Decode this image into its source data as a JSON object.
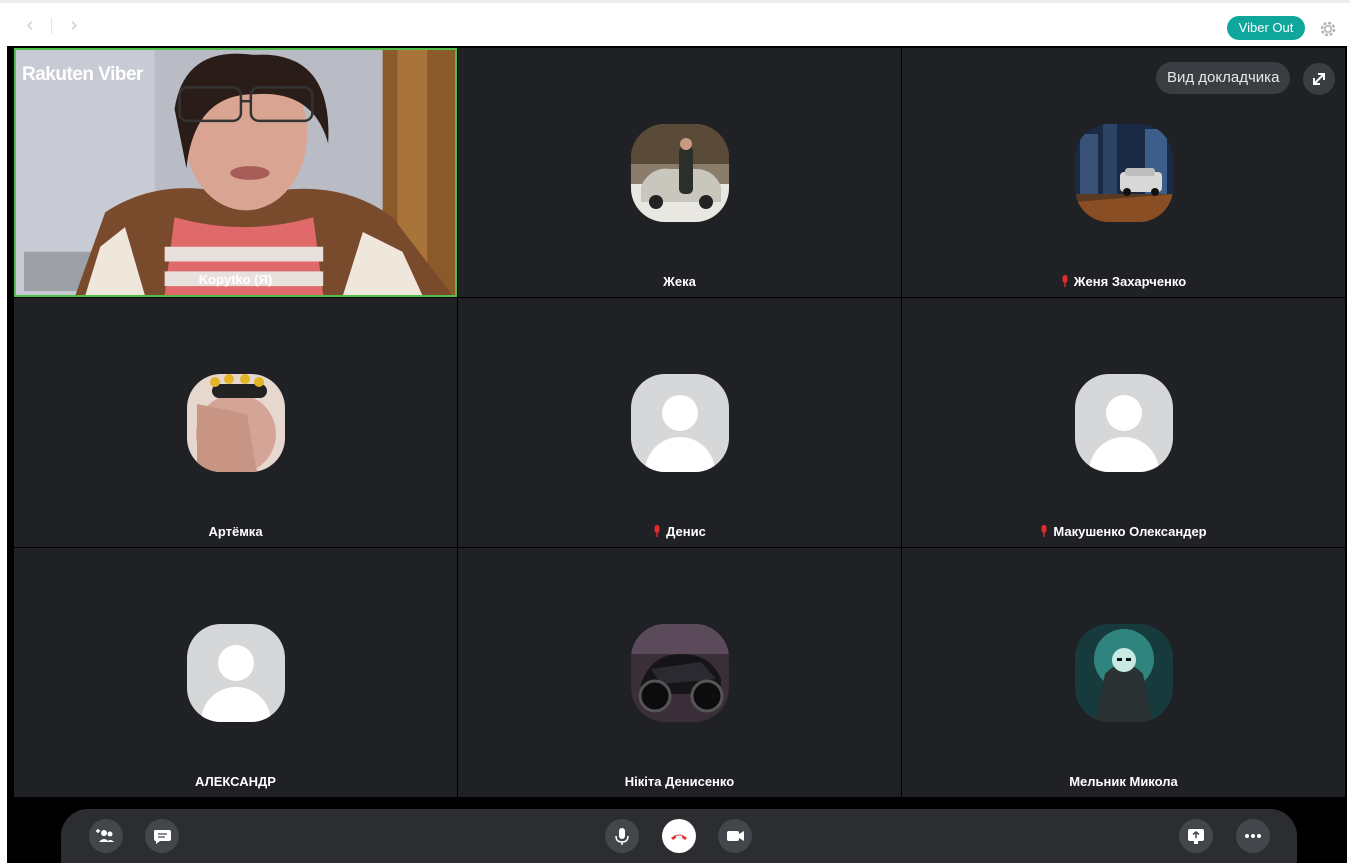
{
  "app": {
    "brand": "Rakuten Viber"
  },
  "topbar": {
    "viber_out_label": "Viber Out",
    "back_icon": "chevron-left-icon",
    "forward_icon": "chevron-right-icon",
    "settings_icon": "gear-icon"
  },
  "call": {
    "speaker_view_label": "Вид докладчика",
    "participants": [
      {
        "name": "Kopytko (Я)",
        "muted": false,
        "avatar": "video"
      },
      {
        "name": "Жека",
        "muted": false,
        "avatar": "photo-car"
      },
      {
        "name": "Женя Захарченко",
        "muted": true,
        "avatar": "photo-city"
      },
      {
        "name": "Артёмка",
        "muted": false,
        "avatar": "photo-hand"
      },
      {
        "name": "Денис",
        "muted": true,
        "avatar": "default"
      },
      {
        "name": "Макушенко Олександер",
        "muted": true,
        "avatar": "default"
      },
      {
        "name": "АЛЕКСАНДР",
        "muted": false,
        "avatar": "default"
      },
      {
        "name": "Нікіта Денисенко",
        "muted": false,
        "avatar": "photo-motorbike"
      },
      {
        "name": "Мельник Микола",
        "muted": false,
        "avatar": "photo-hero"
      }
    ]
  },
  "controls": {
    "add_participant_icon": "add-people-icon",
    "chat_icon": "chat-icon",
    "mic_icon": "microphone-icon",
    "end_call_icon": "hang-up-icon",
    "camera_icon": "camera-icon",
    "screen_share_icon": "screen-share-icon",
    "more_icon": "more-icon"
  },
  "colors": {
    "accent": "#0fa69b",
    "end_call": "#e53935",
    "active_speaker": "#4fbf4a",
    "muted_mic": "#e02b2b"
  }
}
